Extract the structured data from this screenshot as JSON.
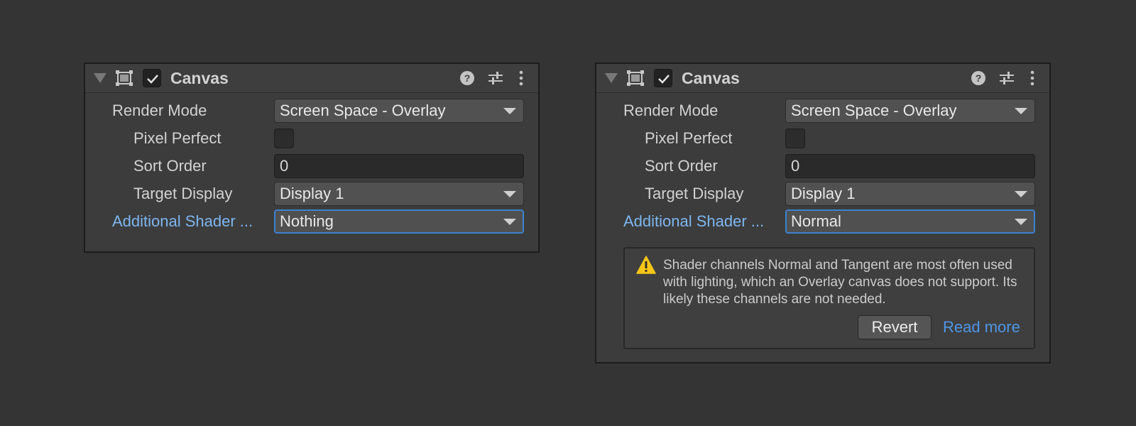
{
  "colors": {
    "background": "#343434",
    "panel": "#3c3c3c",
    "accent_label": "#7db6f0",
    "focus_border": "#3c82d0",
    "link": "#4e97e8",
    "warning": "#f5c518"
  },
  "panels": [
    {
      "header": {
        "fold_icon": "triangle-down-icon",
        "component_icon": "rect-transform-icon",
        "enabled": true,
        "title": "Canvas",
        "icons": [
          "help-icon",
          "presets-icon",
          "more-vertical-icon"
        ]
      },
      "render_mode": {
        "label": "Render Mode",
        "value": "Screen Space - Overlay"
      },
      "pixel_perfect": {
        "label": "Pixel Perfect",
        "checked": false
      },
      "sort_order": {
        "label": "Sort Order",
        "value": "0"
      },
      "target_display": {
        "label": "Target Display",
        "value": "Display 1"
      },
      "additional_shader": {
        "label": "Additional Shader ...",
        "value": "Nothing",
        "focused": true
      }
    },
    {
      "header": {
        "fold_icon": "triangle-down-icon",
        "component_icon": "rect-transform-icon",
        "enabled": true,
        "title": "Canvas",
        "icons": [
          "help-icon",
          "presets-icon",
          "more-vertical-icon"
        ]
      },
      "render_mode": {
        "label": "Render Mode",
        "value": "Screen Space - Overlay"
      },
      "pixel_perfect": {
        "label": "Pixel Perfect",
        "checked": false
      },
      "sort_order": {
        "label": "Sort Order",
        "value": "0"
      },
      "target_display": {
        "label": "Target Display",
        "value": "Display 1"
      },
      "additional_shader": {
        "label": "Additional Shader ...",
        "value": "Normal",
        "focused": true
      },
      "warning": {
        "icon": "warning-icon",
        "message": "Shader channels Normal and Tangent are most often used with lighting, which an Overlay canvas does not support. Its likely these channels are not needed.",
        "revert_label": "Revert",
        "read_more_label": "Read more"
      }
    }
  ]
}
